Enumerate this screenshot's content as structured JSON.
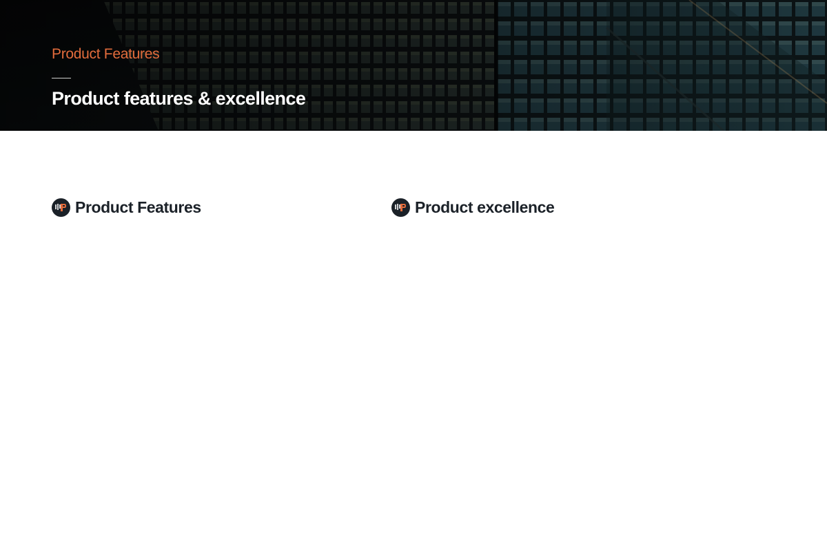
{
  "hero": {
    "eyebrow": "Product Features",
    "title": "Product features & excellence"
  },
  "sections": [
    {
      "icon": "brand-logo-icon",
      "heading": "Product Features"
    },
    {
      "icon": "brand-logo-icon",
      "heading": "Product excellence"
    }
  ],
  "colors": {
    "accent": "#e36c3c",
    "heading": "#1b2128",
    "hero_text": "#ffffff"
  }
}
